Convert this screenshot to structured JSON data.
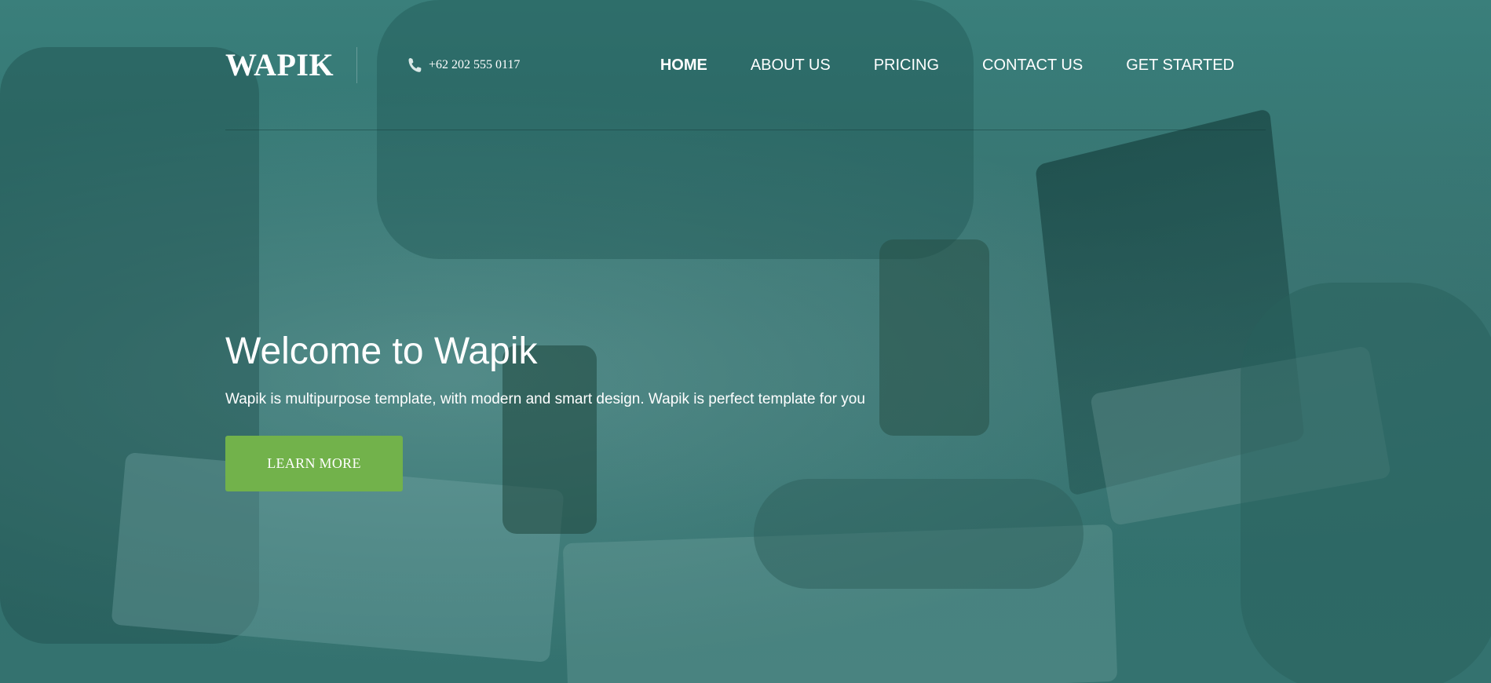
{
  "brand": {
    "logo_text": "WAPIK"
  },
  "contact": {
    "phone": "+62 202 555 0117",
    "phone_icon": "phone-icon"
  },
  "nav": {
    "items": [
      {
        "label": "HOME",
        "active": true
      },
      {
        "label": "ABOUT US",
        "active": false
      },
      {
        "label": "PRICING",
        "active": false
      },
      {
        "label": "CONTACT US",
        "active": false
      },
      {
        "label": "GET STARTED",
        "active": false
      }
    ]
  },
  "hero": {
    "title": "Welcome to Wapik",
    "subtitle": "Wapik is multipurpose template, with modern and smart design. Wapik is perfect template for you",
    "cta_label": "LEARN MORE"
  },
  "colors": {
    "overlay": "#2f6e6b",
    "cta": "#72b24b",
    "text": "#ffffff"
  }
}
